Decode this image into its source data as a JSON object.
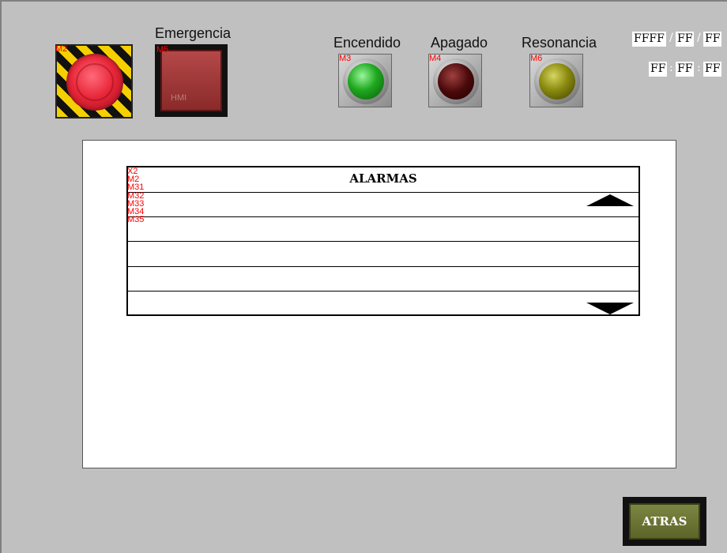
{
  "header": {
    "estop_tag": "M2",
    "emergency_title": "Emergencia",
    "emergency_tag": "M5",
    "watermark": "HMI"
  },
  "lights": [
    {
      "title": "Encendido",
      "tag": "M3",
      "color": "#1fa81f"
    },
    {
      "title": "Apagado",
      "tag": "M4",
      "color": "#4a0a0a"
    },
    {
      "title": "Resonancia",
      "tag": "M6",
      "color": "#8a8a10"
    }
  ],
  "datetime": {
    "year": "FFFF",
    "month": "FF",
    "day": "FF",
    "hour": "FF",
    "minute": "FF",
    "second": "FF",
    "date_sep": "/",
    "time_sep": ":"
  },
  "alarms": {
    "title": "ALARMAS",
    "tags": [
      "X2",
      "M2",
      "M31",
      "M32",
      "M33",
      "M34",
      "M35"
    ]
  },
  "footer": {
    "back_label": "ATRAS"
  }
}
